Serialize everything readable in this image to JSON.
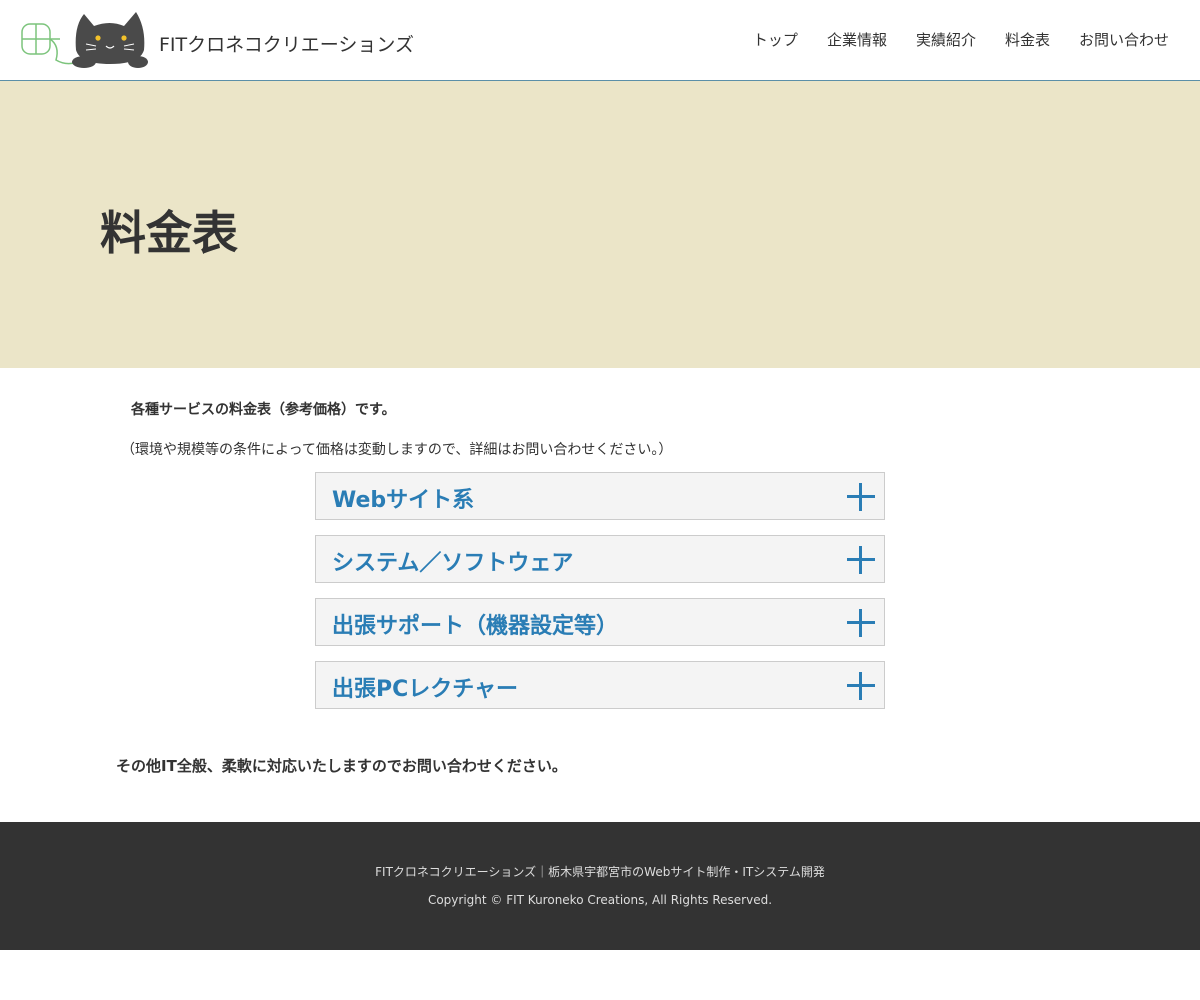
{
  "header": {
    "site_title": "FITクロネコクリエーションズ",
    "logo_icon": "cat-logo-icon",
    "nav": [
      {
        "label": "トップ"
      },
      {
        "label": "企業情報"
      },
      {
        "label": "実績紹介"
      },
      {
        "label": "料金表"
      },
      {
        "label": "お問い合わせ"
      }
    ]
  },
  "hero": {
    "title": "料金表",
    "background_color": "#ebe5c8"
  },
  "content": {
    "intro_bold": "各種サービスの料金表（参考価格）です。",
    "intro_note": "（環境や規模等の条件によって価格は変動しますので、詳細はお問い合わせください。）",
    "accordion": [
      {
        "label": "Webサイト系",
        "icon": "plus-icon"
      },
      {
        "label": "システム／ソフトウェア",
        "icon": "plus-icon"
      },
      {
        "label": "出張サポート（機器設定等）",
        "icon": "plus-icon"
      },
      {
        "label": "出張PCレクチャー",
        "icon": "plus-icon"
      }
    ],
    "closing": "その他IT全般、柔軟に対応いたしますのでお問い合わせください。",
    "accent_color": "#2a7db5"
  },
  "footer": {
    "line1": "FITクロネコクリエーションズ｜栃木県宇都宮市のWebサイト制作・ITシステム開発",
    "copyright": "Copyright © FIT Kuroneko Creations, All Rights Reserved."
  }
}
